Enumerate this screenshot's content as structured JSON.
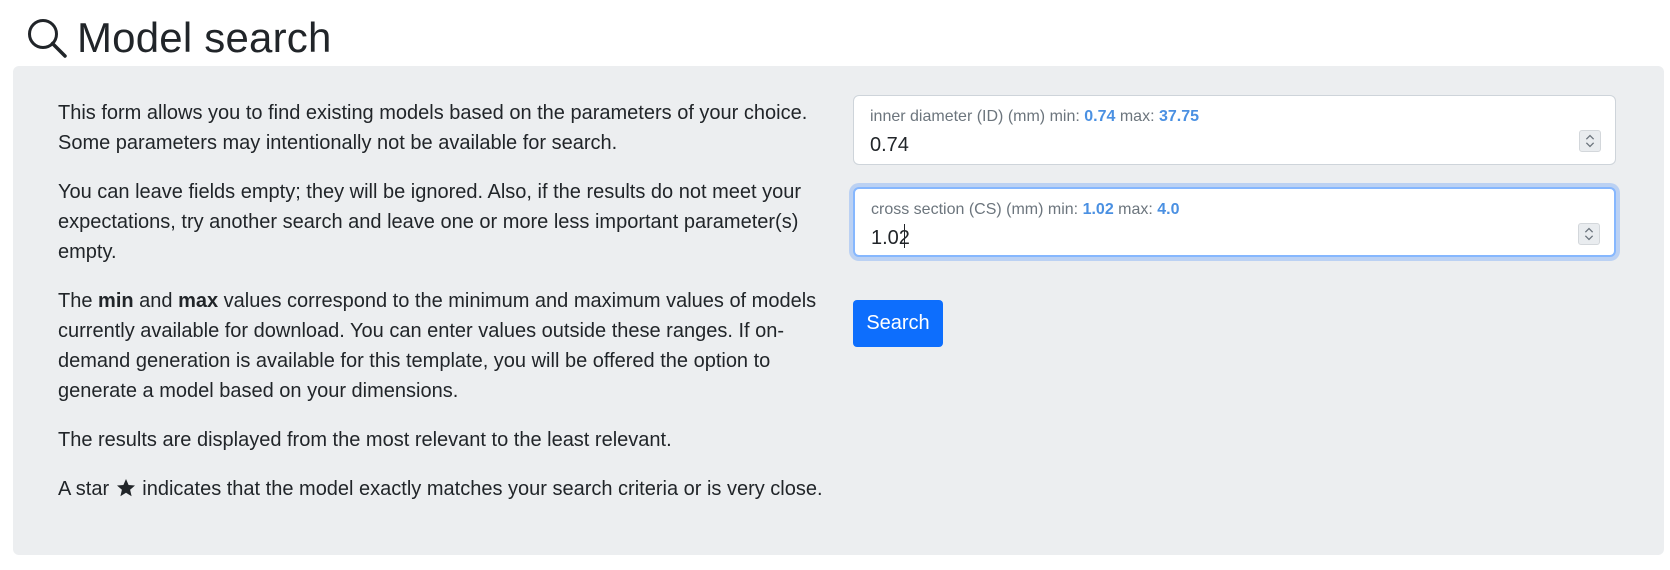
{
  "header": {
    "title": "Model search"
  },
  "help": {
    "p1": "This form allows you to find existing models based on the parameters of your choice. Some parameters may intentionally not be available for search.",
    "p2": "You can leave fields empty; they will be ignored. Also, if the results do not meet your expectations, try another search and leave one or more less important parameter(s) empty.",
    "p3_intro": "The ",
    "p3_min": "min",
    "p3_and": " and ",
    "p3_max": "max",
    "p3_rest": " values correspond to the minimum and maximum values of models currently available for download. You can enter values outside these ranges. If on-demand generation is available for this template, you will be offered the option to generate a model based on your dimensions.",
    "p4": "The results are displayed from the most relevant to the least relevant.",
    "p5_before": "A star ",
    "p5_after": " indicates that the model exactly matches your search criteria or is very close."
  },
  "fields": [
    {
      "label": "inner diameter (ID) (mm) min: ",
      "min": "0.74",
      "max_label": " max: ",
      "max": "37.75",
      "value": "0.74"
    },
    {
      "label": "cross section (CS) (mm) min: ",
      "min": "1.02",
      "max_label": " max: ",
      "max": "4.0",
      "value": "1.02"
    }
  ],
  "search_button": "Search",
  "icons": {
    "header": "search-icon",
    "star": "star-icon",
    "spinner": "spinner-icon"
  },
  "colors": {
    "panel": "#eceef0",
    "primary": "#0d6efd",
    "minmax": "#4a90e2"
  }
}
